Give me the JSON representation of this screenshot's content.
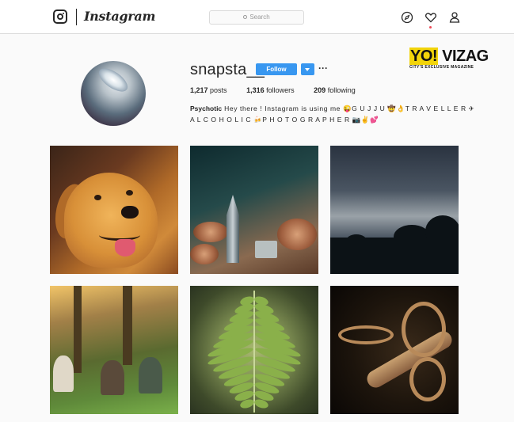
{
  "app": {
    "name": "Instagram"
  },
  "nav": {
    "search_placeholder": "Search",
    "icons": [
      "instagram-camera-icon",
      "compass-icon",
      "heart-icon",
      "person-icon"
    ]
  },
  "profile": {
    "username": "snapsta__",
    "follow_label": "Follow",
    "more_label": "···",
    "stats": {
      "posts_count": "1,217",
      "posts_label": "posts",
      "followers_count": "1,316",
      "followers_label": "followers",
      "following_count": "209",
      "following_label": "following"
    },
    "bio": {
      "name": "Psychotic",
      "text": "Hey there ! Instagram is using me 😜G U J J U 🤠👌T R A V E L L E R ✈ A L C O H O L I C 🍻P H O T O G R A P H E R 📷✌💕"
    }
  },
  "watermark": {
    "yo": "YO!",
    "brand": " VIZAG",
    "tagline": "CITY'S EXCLUSIVE MAGAZINE"
  },
  "posts": [
    {
      "subject": "dog"
    },
    {
      "subject": "pencil"
    },
    {
      "subject": "palm-sky"
    },
    {
      "subject": "people-forest"
    },
    {
      "subject": "fern"
    },
    {
      "subject": "snake"
    }
  ],
  "colors": {
    "follow_blue": "#3897f0",
    "text": "#262626",
    "border": "#dbdbdb",
    "background": "#fafafa",
    "notification_red": "#ed4956",
    "watermark_yellow": "#f2d40a"
  }
}
